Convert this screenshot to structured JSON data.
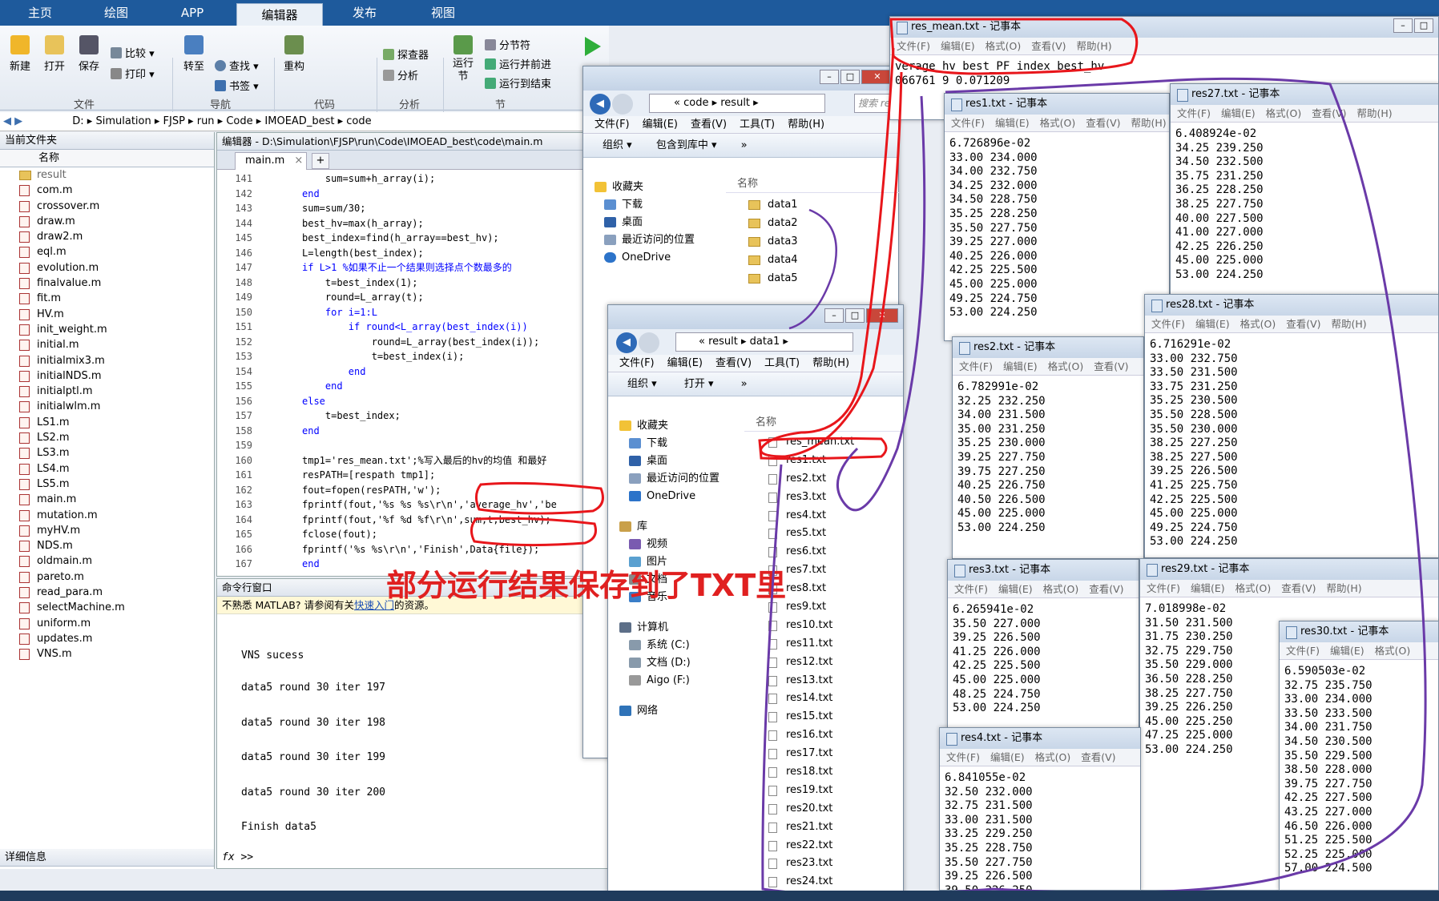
{
  "matlab": {
    "tabs": [
      "主页",
      "绘图",
      "APP",
      "编辑器",
      "发布",
      "视图"
    ],
    "ribbon": {
      "new": "新建",
      "open": "打开",
      "save": "保存",
      "compare": "比较",
      "print": "打印",
      "goto": "转至",
      "find": "查找",
      "bookmark": "书签",
      "refactor": "重构",
      "inspector": "探查器",
      "analyze": "分析",
      "run_section": "运行\n节",
      "section_break": "分节符",
      "run_advance": "运行并前进",
      "run_to_end": "运行到结束",
      "groups": [
        "文件",
        "导航",
        "代码",
        "分析",
        "节"
      ]
    },
    "address": [
      "D:",
      "Simulation",
      "FJSP",
      "run",
      "Code",
      "IMOEAD_best",
      "code"
    ],
    "current_folder": {
      "title": "当前文件夹",
      "col_name": "名称",
      "files": [
        "result",
        "com.m",
        "crossover.m",
        "draw.m",
        "draw2.m",
        "eql.m",
        "evolution.m",
        "finalvalue.m",
        "fit.m",
        "HV.m",
        "init_weight.m",
        "initial.m",
        "initialmix3.m",
        "initialNDS.m",
        "initialptl.m",
        "initialwlm.m",
        "LS1.m",
        "LS2.m",
        "LS3.m",
        "LS4.m",
        "LS5.m",
        "main.m",
        "mutation.m",
        "myHV.m",
        "NDS.m",
        "oldmain.m",
        "pareto.m",
        "read_para.m",
        "selectMachine.m",
        "uniform.m",
        "updates.m",
        "VNS.m"
      ],
      "details": "详细信息"
    },
    "editor": {
      "title": "编辑器 - D:\\Simulation\\FJSP\\run\\Code\\IMOEAD_best\\code\\main.m",
      "tab": "main.m",
      "lines": [
        {
          "n": "141",
          "code": "    sum=sum+h_array(i);"
        },
        {
          "n": "142",
          "code": "end"
        },
        {
          "n": "143",
          "code": "sum=sum/30;"
        },
        {
          "n": "144",
          "code": "best_hv=max(h_array);"
        },
        {
          "n": "145",
          "code": "best_index=find(h_array==best_hv);"
        },
        {
          "n": "146",
          "code": "L=length(best_index);"
        },
        {
          "n": "147",
          "code": "if L>1 %如果不止一个结果则选择点个数最多的"
        },
        {
          "n": "148",
          "code": "    t=best_index(1);"
        },
        {
          "n": "149",
          "code": "    round=L_array(t);"
        },
        {
          "n": "150",
          "code": "    for i=1:L"
        },
        {
          "n": "151",
          "code": "        if round<L_array(best_index(i))"
        },
        {
          "n": "152",
          "code": "            round=L_array(best_index(i));"
        },
        {
          "n": "153",
          "code": "            t=best_index(i);"
        },
        {
          "n": "154",
          "code": "        end"
        },
        {
          "n": "155",
          "code": "    end"
        },
        {
          "n": "156",
          "code": "else"
        },
        {
          "n": "157",
          "code": "    t=best_index;"
        },
        {
          "n": "158",
          "code": "end"
        },
        {
          "n": "159",
          "code": ""
        },
        {
          "n": "160",
          "code": "tmp1='res_mean.txt';%写入最后的hv的均值 和最好"
        },
        {
          "n": "161",
          "code": "resPATH=[respath tmp1];"
        },
        {
          "n": "162",
          "code": "fout=fopen(resPATH,'w');"
        },
        {
          "n": "163",
          "code": "fprintf(fout,'%s %s %s\\r\\n','average_hv','be"
        },
        {
          "n": "164",
          "code": "fprintf(fout,'%f %d %f\\r\\n',sum,t,best_hv);"
        },
        {
          "n": "165",
          "code": "fclose(fout);"
        },
        {
          "n": "166",
          "code": "fprintf('%s %s\\r\\n','Finish',Data{file});"
        },
        {
          "n": "167",
          "code": "end"
        }
      ]
    },
    "command_window": {
      "title": "命令行窗口",
      "notice_pre": "不熟悉 MATLAB? 请参阅有关",
      "notice_link": "快速入门",
      "notice_post": "的资源。",
      "output": [
        "VNS sucess",
        "data5 round 30 iter 197",
        "data5 round 30 iter 198",
        "data5 round 30 iter 199",
        "data5 round 30 iter 200",
        "Finish  data5"
      ],
      "prompt": "fx >>"
    }
  },
  "annotation": "部分运行结果保存到了TXT里",
  "explorer1": {
    "path": [
      "code",
      "result"
    ],
    "search": "搜索 re",
    "menu": [
      "文件(F)",
      "编辑(E)",
      "查看(V)",
      "工具(T)",
      "帮助(H)"
    ],
    "toolbar": [
      "组织 ▾",
      "包含到库中 ▾",
      "»"
    ],
    "nav": [
      "收藏夹",
      "下载",
      "桌面",
      "最近访问的位置",
      "OneDrive"
    ],
    "col": "名称",
    "items": [
      "data1",
      "data2",
      "data3",
      "data4",
      "data5"
    ]
  },
  "explorer2": {
    "path": [
      "result",
      "data1"
    ],
    "menu": [
      "文件(F)",
      "编辑(E)",
      "查看(V)",
      "工具(T)",
      "帮助(H)"
    ],
    "toolbar": [
      "组织 ▾",
      "打开 ▾",
      "»"
    ],
    "nav": [
      "收藏夹",
      "下载",
      "桌面",
      "最近访问的位置",
      "OneDrive",
      "库",
      "视频",
      "图片",
      "文档",
      "音乐",
      "计算机",
      "系统 (C:)",
      "文档 (D:)",
      "Aigo (F:)",
      "网络"
    ],
    "col": "名称",
    "items": [
      "res_mean.txt",
      "res1.txt",
      "res2.txt",
      "res3.txt",
      "res4.txt",
      "res5.txt",
      "res6.txt",
      "res7.txt",
      "res8.txt",
      "res9.txt",
      "res10.txt",
      "res11.txt",
      "res12.txt",
      "res13.txt",
      "res14.txt",
      "res15.txt",
      "res16.txt",
      "res17.txt",
      "res18.txt",
      "res19.txt",
      "res20.txt",
      "res21.txt",
      "res22.txt",
      "res23.txt",
      "res24.txt"
    ]
  },
  "notepad_menu": [
    "文件(F)",
    "编辑(E)",
    "格式(O)",
    "查看(V)",
    "帮助(H)"
  ],
  "notepads": [
    {
      "id": "res_mean",
      "title": "res_mean.txt - 记事本",
      "text": "verage_hv best_PF_index best_hv\n066761 9 0.071209"
    },
    {
      "id": "res1",
      "title": "res1.txt - 记事本",
      "text": "6.726896e-02\n33.00 234.000\n34.00 232.750\n34.25 232.000\n34.50 228.750\n35.25 228.250\n35.50 227.750\n39.25 227.000\n40.25 226.000\n42.25 225.500\n45.00 225.000\n49.25 224.750\n53.00 224.250"
    },
    {
      "id": "res27",
      "title": "res27.txt - 记事本",
      "text": "6.408924e-02\n34.25 239.250\n34.50 232.500\n35.75 231.250\n36.25 228.250\n38.25 227.750\n40.00 227.500\n41.00 227.000\n42.25 226.250\n45.00 225.000\n53.00 224.250"
    },
    {
      "id": "res2",
      "title": "res2.txt - 记事本",
      "text": "6.782991e-02\n32.25 232.250\n34.00 231.500\n35.00 231.250\n35.25 230.000\n39.25 227.750\n39.75 227.250\n40.25 226.750\n40.50 226.500\n45.00 225.000\n53.00 224.250"
    },
    {
      "id": "res28",
      "title": "res28.txt - 记事本",
      "text": "6.716291e-02\n33.00 232.750\n33.50 231.500\n33.75 231.250\n35.25 230.500\n35.50 228.500\n35.50 230.000\n38.25 227.250\n38.25 227.500\n39.25 226.500\n41.25 225.750\n42.25 225.500\n45.00 225.000\n49.25 224.750\n53.00 224.250"
    },
    {
      "id": "res3",
      "title": "res3.txt - 记事本",
      "text": "6.265941e-02\n35.50 227.000\n39.25 226.500\n41.25 226.000\n42.25 225.500\n45.00 225.000\n48.25 224.750\n53.00 224.250"
    },
    {
      "id": "res29",
      "title": "res29.txt - 记事本",
      "text": "7.018998e-02\n31.50 231.500\n31.75 230.250\n32.75 229.750\n35.50 229.000\n36.50 228.250\n38.25 227.750\n39.25 226.250\n45.00 225.250\n47.25 225.000\n53.00 224.250"
    },
    {
      "id": "res30",
      "title": "res30.txt - 记事本",
      "text": "6.590503e-02\n32.75 235.750\n33.00 234.000\n33.50 233.500\n34.00 231.750\n34.50 230.500\n35.50 229.500\n38.50 228.000\n39.75 227.750\n42.25 227.500\n43.25 227.000\n46.50 226.000\n51.25 225.500\n52.25 225.000\n57.00 224.500"
    },
    {
      "id": "res4",
      "title": "res4.txt - 记事本",
      "text": "6.841055e-02\n32.50 232.000\n32.75 231.500\n33.00 231.500\n33.25 229.250\n35.25 228.750\n35.50 227.750\n39.25 226.500\n39.50 226.250"
    }
  ],
  "colors": {
    "matlab_blue": "#1e5a9c",
    "annotation_red": "#e02020",
    "circle_red": "#e8161b",
    "circle_purple": "#6a3aa8"
  }
}
